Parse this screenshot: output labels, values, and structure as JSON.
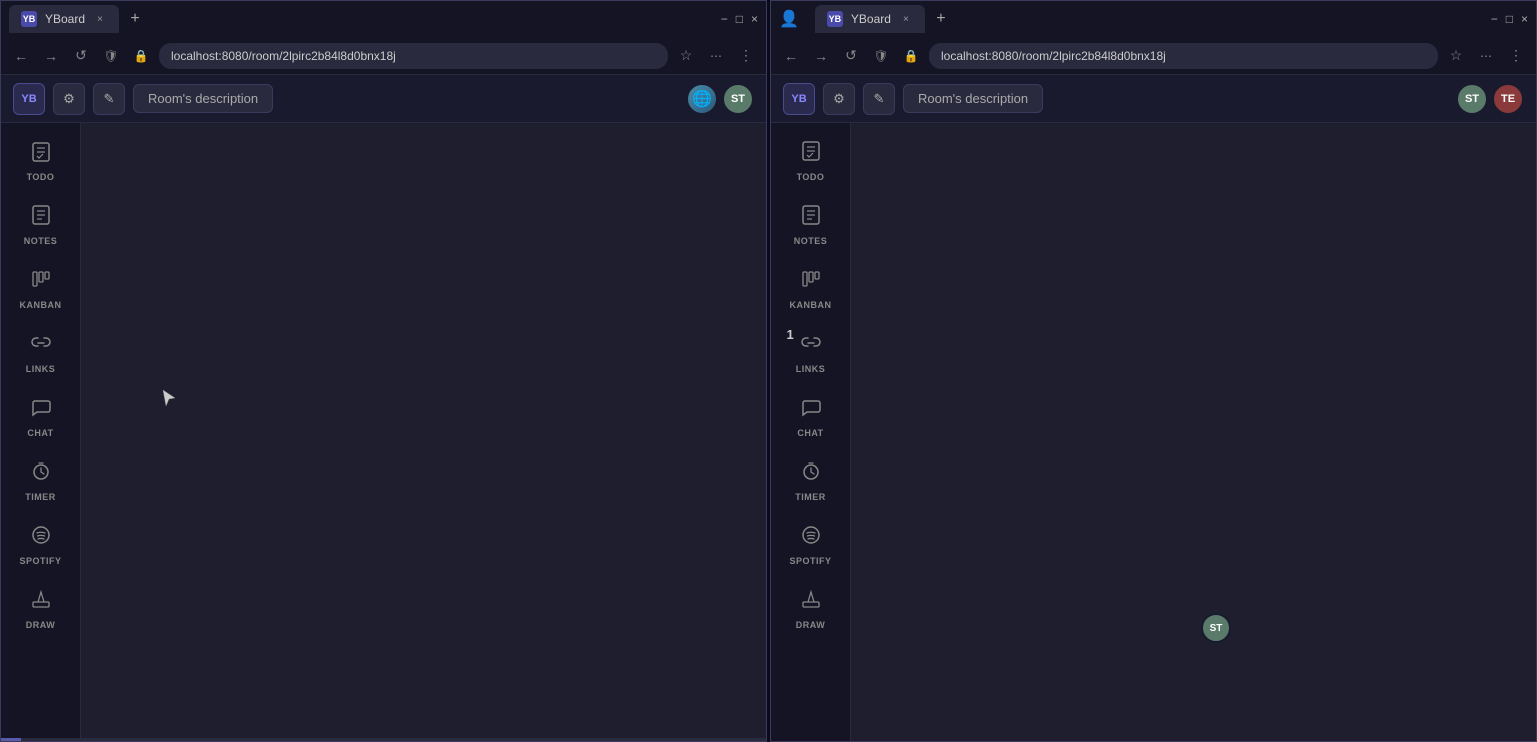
{
  "windows": [
    {
      "id": "window-left",
      "tab": {
        "favicon": "YB",
        "title": "YBoard",
        "close_label": "×",
        "new_tab_label": "+"
      },
      "window_controls": {
        "minimize": "−",
        "maximize": "□",
        "close": "×"
      },
      "address_bar": {
        "back": "←",
        "forward": "→",
        "reload": "↺",
        "url": "localhost:8080/room/2lpirc2b84l8d0bnx18j",
        "bookmark": "☆",
        "more": "⋮"
      },
      "app_header": {
        "logo": "YB",
        "settings_icon": "⚙",
        "edit_icon": "✎",
        "room_description": "Room's description",
        "avatars": [
          {
            "initials": "ST",
            "color": "#5a8aaa",
            "bg": "#3a6a8a"
          }
        ]
      },
      "sidebar": {
        "items": [
          {
            "id": "todo",
            "icon": "📋",
            "label": "TODO",
            "badge": null
          },
          {
            "id": "notes",
            "icon": "📝",
            "label": "NOTES",
            "badge": null
          },
          {
            "id": "kanban",
            "icon": "📊",
            "label": "KANBAN",
            "badge": null
          },
          {
            "id": "links",
            "icon": "🔖",
            "label": "LINKS",
            "badge": null
          },
          {
            "id": "chat",
            "icon": "💬",
            "label": "CHAT",
            "badge": null
          },
          {
            "id": "timer",
            "icon": "⏱",
            "label": "TIMER",
            "badge": null
          },
          {
            "id": "spotify",
            "icon": "🎵",
            "label": "SPOTIFY",
            "badge": null
          },
          {
            "id": "draw",
            "icon": "✏",
            "label": "DRAW",
            "badge": null
          }
        ]
      },
      "canvas": {
        "cursor_visible": true
      }
    },
    {
      "id": "window-right",
      "tab": {
        "favicon": "YB",
        "title": "YBoard",
        "close_label": "×",
        "new_tab_label": "+"
      },
      "window_controls": {
        "minimize": "−",
        "maximize": "□",
        "close": "×",
        "is_right": true
      },
      "address_bar": {
        "back": "←",
        "forward": "→",
        "reload": "↺",
        "url": "localhost:8080/room/2lpirc2b84l8d0bnx18j",
        "bookmark": "☆",
        "more": "⋮"
      },
      "app_header": {
        "logo": "YB",
        "settings_icon": "⚙",
        "edit_icon": "✎",
        "room_description": "Room's description",
        "avatars": [
          {
            "initials": "ST",
            "color": "#5a8aaa",
            "bg": "#5a7a6a"
          },
          {
            "initials": "TE",
            "color": "#aa5a5a",
            "bg": "#8a3a3a"
          }
        ]
      },
      "sidebar": {
        "items": [
          {
            "id": "todo",
            "icon": "📋",
            "label": "TODO",
            "badge": null
          },
          {
            "id": "notes",
            "icon": "📝",
            "label": "NOTES",
            "badge": null
          },
          {
            "id": "kanban",
            "icon": "📊",
            "label": "KANBAN",
            "badge": null
          },
          {
            "id": "links",
            "icon": "🔖",
            "label": "LINKS",
            "badge": "1"
          },
          {
            "id": "chat",
            "icon": "💬",
            "label": "CHAT",
            "badge": null
          },
          {
            "id": "timer",
            "icon": "⏱",
            "label": "TIMER",
            "badge": null
          },
          {
            "id": "spotify",
            "icon": "🎵",
            "label": "SPOTIFY",
            "badge": null
          },
          {
            "id": "draw",
            "icon": "✏",
            "label": "DRAW",
            "badge": null
          }
        ]
      },
      "canvas": {
        "cursor_visible": false,
        "user_cursor": {
          "initials": "ST",
          "color": "#5a7a6a"
        }
      }
    }
  ]
}
